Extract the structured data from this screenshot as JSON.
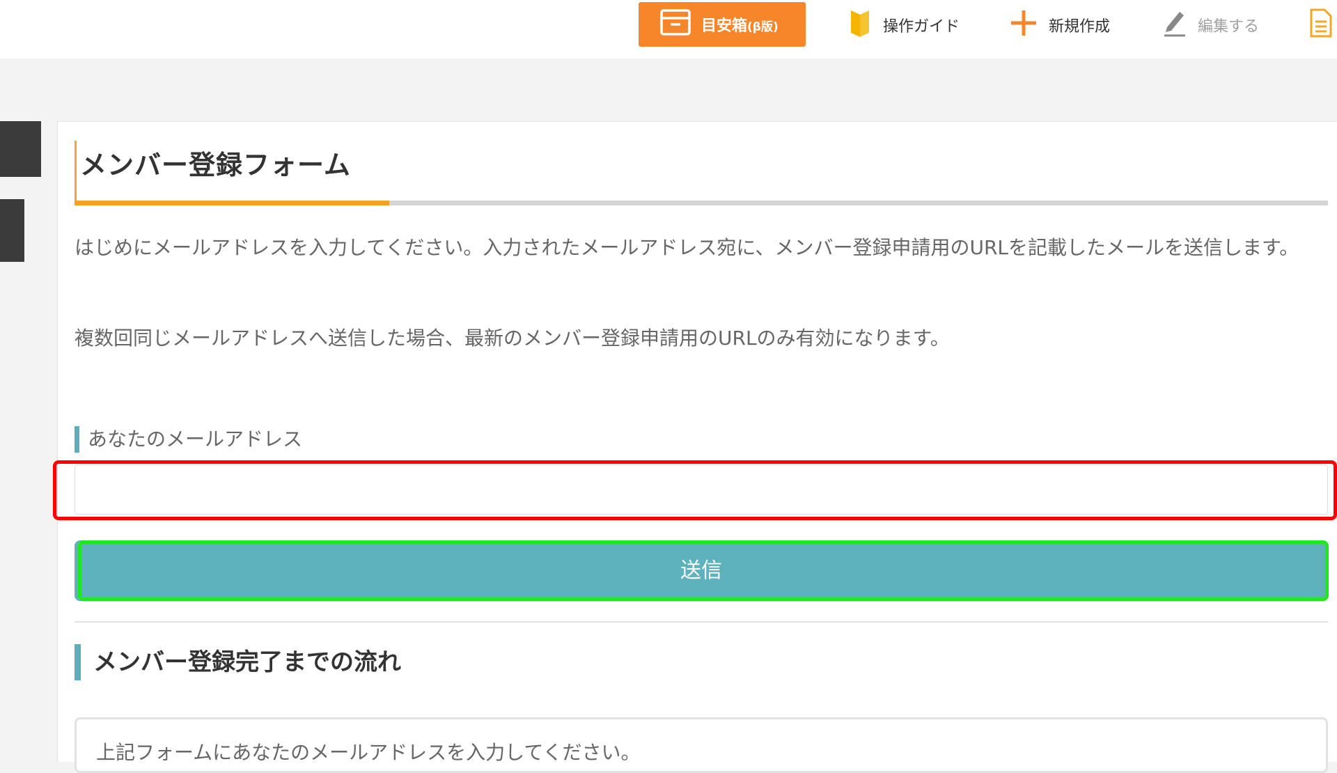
{
  "toolbar": {
    "meyasu": {
      "label": "目安箱",
      "suffix": "(β版)"
    },
    "guide": {
      "label": "操作ガイド"
    },
    "new": {
      "label": "新規作成"
    },
    "edit": {
      "label": "編集する"
    }
  },
  "form": {
    "title": "メンバー登録フォーム",
    "intro": "はじめにメールアドレスを入力してください。入力されたメールアドレス宛に、メンバー登録申請用のURLを記載したメールを送信します。",
    "note": "複数回同じメールアドレスへ送信した場合、最新のメンバー登録申請用のURLのみ有効になります。",
    "email_label": "あなたのメールアドレス",
    "email_value": "",
    "submit_label": "送信"
  },
  "flow": {
    "title": "メンバー登録完了までの流れ",
    "step1": "上記フォームにあなたのメールアドレスを入力してください。"
  },
  "colors": {
    "orange": "#f7862a",
    "teal": "#5eb2bd",
    "highlight_red": "#ff0000",
    "highlight_green": "#22e61e"
  },
  "icons": {
    "meyasu": "archive-box-icon",
    "guide": "beginner-mark-icon",
    "new": "plus-icon",
    "edit": "pencil-icon",
    "doc": "document-icon"
  }
}
